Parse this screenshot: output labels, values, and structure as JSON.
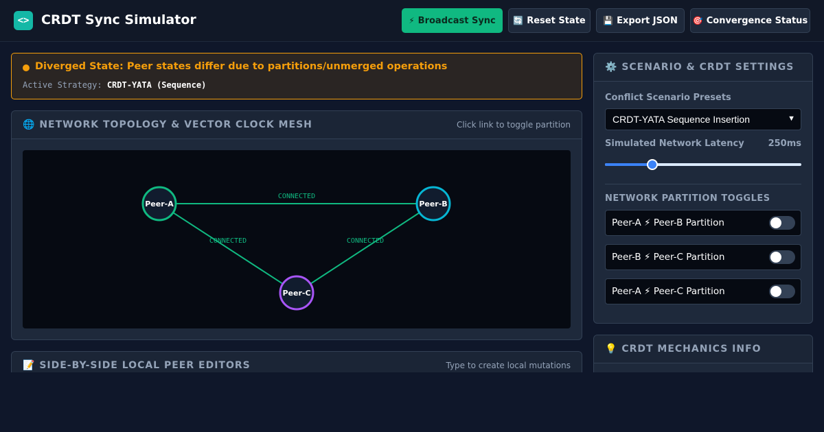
{
  "header": {
    "logo_text": "<>",
    "title": "CRDT Sync Simulator",
    "buttons": [
      {
        "icon": "⚡",
        "label": "Broadcast Sync"
      },
      {
        "icon": "🔄",
        "label": "Reset State"
      },
      {
        "icon": "💾",
        "label": "Export JSON"
      },
      {
        "icon": "🎯",
        "label": "Convergence Status"
      }
    ]
  },
  "alert": {
    "title": "Diverged State: Peer states differ due to partitions/unmerged operations",
    "strategy_label": "Active Strategy:",
    "strategy_value": "CRDT-YATA (Sequence)",
    "color": "#f59e0b"
  },
  "topology": {
    "icon": "🌐",
    "title": "NETWORK TOPOLOGY & VECTOR CLOCK MESH",
    "hint": "Click link to toggle partition",
    "nodes": [
      {
        "id": "a",
        "label": "Peer-A",
        "color": "#10b981"
      },
      {
        "id": "b",
        "label": "Peer-B",
        "color": "#06b6d4"
      },
      {
        "id": "c",
        "label": "Peer-C",
        "color": "#a855f7"
      }
    ],
    "links": [
      {
        "from": "a",
        "to": "b",
        "status": "CONNECTED"
      },
      {
        "from": "a",
        "to": "c",
        "status": "CONNECTED"
      },
      {
        "from": "b",
        "to": "c",
        "status": "CONNECTED"
      }
    ],
    "link_color": "#10b981"
  },
  "editors": {
    "icon": "📝",
    "title": "SIDE-BY-SIDE LOCAL PEER EDITORS",
    "hint": "Type to create local mutations"
  },
  "settings": {
    "icon": "⚙️",
    "title": "SCENARIO & CRDT SETTINGS",
    "preset_label": "Conflict Scenario Presets",
    "preset_value": "CRDT-YATA Sequence Insertion",
    "latency_label": "Simulated Network Latency",
    "latency_value": "250ms",
    "latency_fraction": 0.24,
    "partition_heading": "NETWORK PARTITION TOGGLES",
    "partitions": [
      {
        "label": "Peer-A ⚡ Peer-B Partition",
        "on": false
      },
      {
        "label": "Peer-B ⚡ Peer-C Partition",
        "on": false
      },
      {
        "label": "Peer-A ⚡ Peer-C Partition",
        "on": false
      }
    ]
  },
  "info": {
    "icon": "💡",
    "title": "CRDT MECHANICS INFO"
  }
}
